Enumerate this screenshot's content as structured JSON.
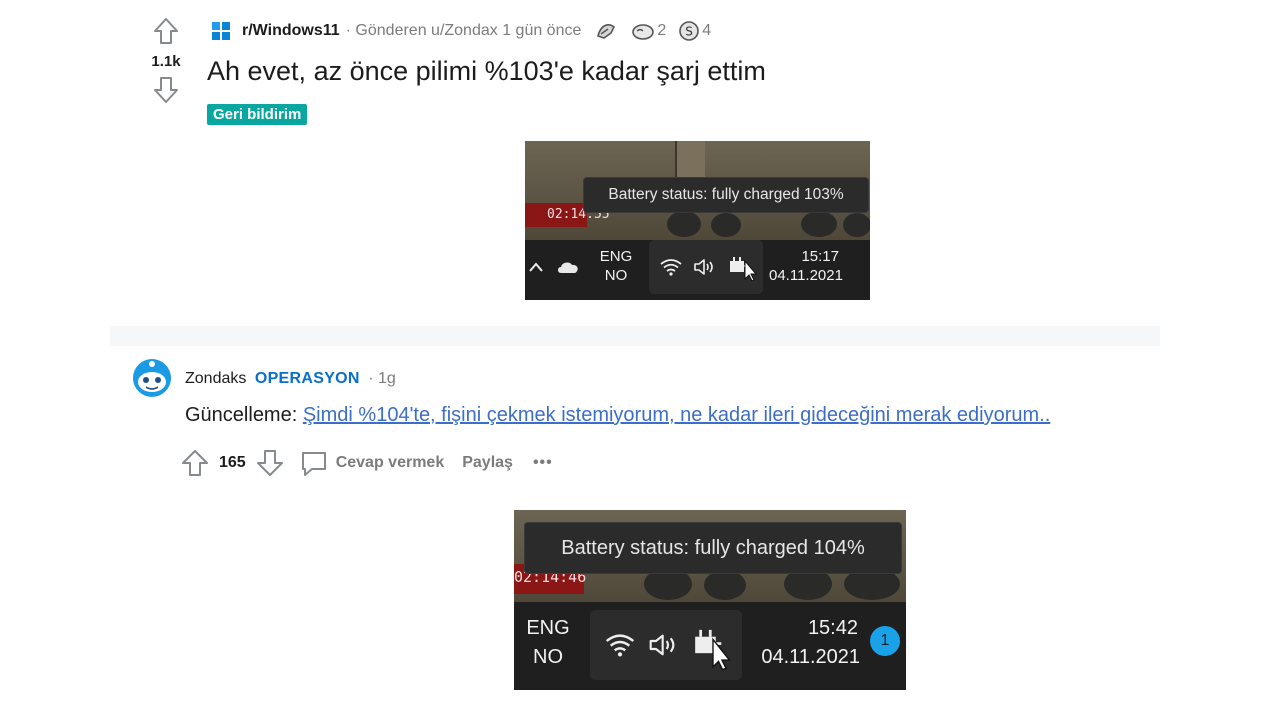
{
  "post": {
    "votes": "1.1k",
    "subreddit": "r/Windows11",
    "posted_by": "· Gönderen u/Zondax 1 gün önce",
    "awards": [
      {
        "icon": "medal-award-icon",
        "count": ""
      },
      {
        "icon": "wholesome-award-icon",
        "count": "2"
      },
      {
        "icon": "silver-award-icon",
        "count": "4"
      }
    ],
    "title": "Ah evet, az önce pilimi %103'e kadar şarj ettim",
    "flair": "Geri bildirim",
    "flair_color": "#0aa7a1"
  },
  "screenshot1": {
    "tooltip": "Battery status: fully charged 103%",
    "game_timer": "02:14:55",
    "lang_top": "ENG",
    "lang_bottom": "NO",
    "time": "15:17",
    "date": "04.11.2021"
  },
  "comment": {
    "author": "Zondaks",
    "flair": "OPERASYON",
    "time": "· 1g",
    "body_prefix": "Güncelleme: ",
    "body_link": "Şimdi %104'te, fişini çekmek istemiyorum, ne kadar ileri gideceğini merak ediyorum..",
    "votes": "165",
    "reply_label": "Cevap vermek",
    "share_label": "Paylaş",
    "more_label": "•••",
    "link_color": "#3d6ec7"
  },
  "screenshot2": {
    "tooltip": "Battery status: fully charged 104%",
    "game_timer": "02:14:46",
    "lang_top": "ENG",
    "lang_bottom": "NO",
    "time": "15:42",
    "date": "04.11.2021",
    "notification_count": "1"
  }
}
